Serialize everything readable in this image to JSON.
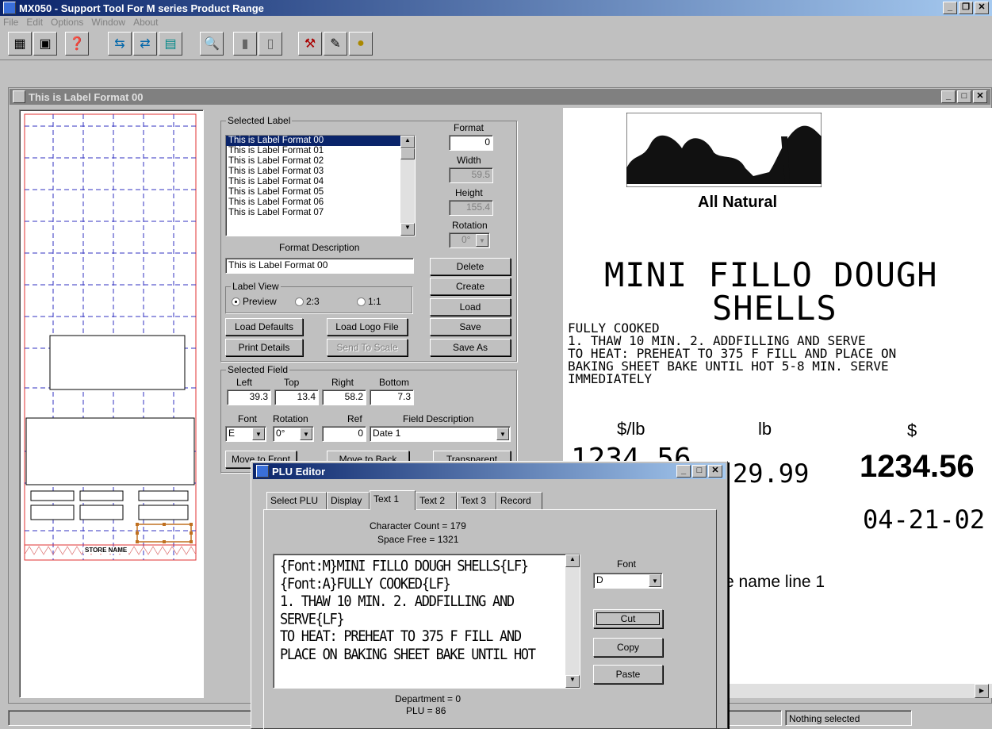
{
  "app": {
    "title": "MX050 - Support Tool For M series Product Range",
    "menu": [
      "File",
      "Edit",
      "Options",
      "Window",
      "About"
    ]
  },
  "child_window": {
    "title": "This is Label Format 00"
  },
  "selected_label": {
    "group_label": "Selected Label",
    "items": [
      "This is Label Format 00",
      "This is Label Format 01",
      "This is Label Format 02",
      "This is Label Format 03",
      "This is Label Format 04",
      "This is Label Format 05",
      "This is Label Format 06",
      "This is Label Format 07"
    ],
    "format_label": "Format",
    "format_value": "0",
    "width_label": "Width",
    "width_value": "59.5",
    "height_label": "Height",
    "height_value": "155.4",
    "rotation_label": "Rotation",
    "rotation_value": "0°",
    "format_desc_label": "Format Description",
    "format_desc_value": "This is Label Format 00",
    "label_view_label": "Label View",
    "view_preview": "Preview",
    "view_23": "2:3",
    "view_11": "1:1",
    "delete": "Delete",
    "create": "Create",
    "load": "Load",
    "save": "Save",
    "save_as": "Save As",
    "load_defaults": "Load Defaults",
    "load_logo": "Load Logo File",
    "print_details": "Print Details",
    "send_to_scale": "Send To Scale"
  },
  "selected_field": {
    "group_label": "Selected Field",
    "left_label": "Left",
    "left": "39.3",
    "top_label": "Top",
    "top": "13.4",
    "right_label": "Right",
    "right": "58.2",
    "bottom_label": "Bottom",
    "bottom": "7.3",
    "font_label": "Font",
    "font": "E",
    "rotation_label": "Rotation",
    "rotation": "0°",
    "ref_label": "Ref",
    "ref": "0",
    "desc_label": "Field Description",
    "desc": "Date 1",
    "move_front": "Move to Front",
    "move_back": "Move to Back",
    "transparent": "Transparent"
  },
  "layout_preview": {
    "store_name": "STORE NAME"
  },
  "label_preview": {
    "logo_text": "All Natural",
    "title_line1": "MINI FILLO DOUGH",
    "title_line2": "SHELLS",
    "body": [
      "FULLY COOKED",
      "1. THAW 10 MIN. 2. ADDFILLING AND SERVE",
      "TO HEAT: PREHEAT TO 375 F FILL AND PLACE ON",
      "BAKING SHEET BAKE UNTIL HOT 5-8 MIN. SERVE",
      "IMMEDIATELY"
    ],
    "unit_price_label": "$/lb",
    "weight_label": "lb",
    "total_label": "$",
    "unit_price": "1234.56",
    "weight": "29.99",
    "total": "1234.56",
    "date": "04-21-02",
    "store_line": "e name line 1"
  },
  "status": {
    "text": "Nothing selected"
  },
  "plu_editor": {
    "title": "PLU Editor",
    "tabs": [
      "Select PLU",
      "Display",
      "Text 1",
      "Text 2",
      "Text 3",
      "Record"
    ],
    "char_count": "Character Count = 179",
    "space_free": "Space Free = 1321",
    "text_lines": [
      "{Font:M}MINI FILLO DOUGH SHELLS{LF}",
      "{Font:A}FULLY COOKED{LF}",
      "1. THAW 10 MIN. 2. ADDFILLING AND",
      "SERVE{LF}",
      "TO HEAT: PREHEAT TO 375 F FILL AND",
      "PLACE ON BAKING SHEET BAKE UNTIL HOT"
    ],
    "font_label": "Font",
    "font_value": "D",
    "cut": "Cut",
    "copy": "Copy",
    "paste": "Paste",
    "department": "Department = 0",
    "plu": "PLU = 86"
  }
}
